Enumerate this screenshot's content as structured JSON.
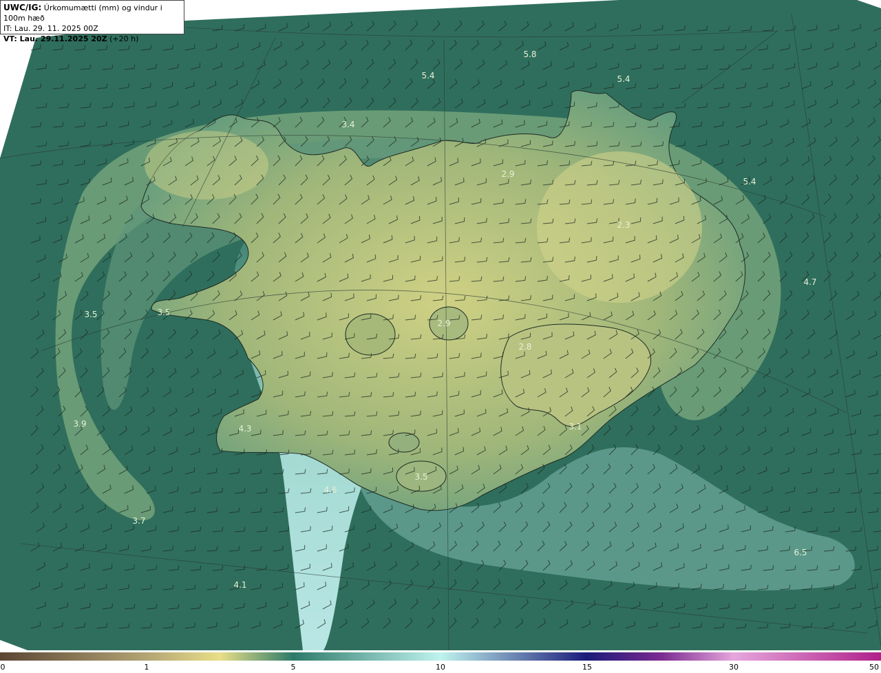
{
  "header": {
    "title_prefix": "UWC/IG:",
    "title_text": "Úrkomumætti (mm) og vindur i 100m hæð",
    "it_line": "IT: Lau. 29. 11. 2025 00Z",
    "vt_prefix": "VT: Lau. 29.11.2025 20Z",
    "vt_suffix": "(+20 h)"
  },
  "values": [
    {
      "text": "5.8"
    },
    {
      "text": "5.4"
    },
    {
      "text": "5.4"
    },
    {
      "text": "3.4"
    },
    {
      "text": "2.9"
    },
    {
      "text": "5.4"
    },
    {
      "text": "2.3"
    },
    {
      "text": "4.7"
    },
    {
      "text": "3.5"
    },
    {
      "text": "3.5"
    },
    {
      "text": "2.9"
    },
    {
      "text": "2.8"
    },
    {
      "text": "3.9"
    },
    {
      "text": "4.3"
    },
    {
      "text": "3.1"
    },
    {
      "text": "3.5"
    },
    {
      "text": "4.6"
    },
    {
      "text": "3.7"
    },
    {
      "text": "6.5"
    },
    {
      "text": "4.1"
    }
  ],
  "colorbar": {
    "ticks": [
      "0",
      "1",
      "5",
      "10",
      "15",
      "30",
      "50"
    ],
    "colors": [
      "#5a4634",
      "#b3a474",
      "#e8df88",
      "#2e7a6a",
      "#bff3ee",
      "#1b1b7a",
      "#7a2a90",
      "#e6a6dd",
      "#b0208a"
    ]
  },
  "colors": {
    "land": "#c7c87c",
    "sea_dark": "#2f6e5c",
    "sea_mid": "#5b9a80",
    "sea_light": "#a7e4da"
  }
}
